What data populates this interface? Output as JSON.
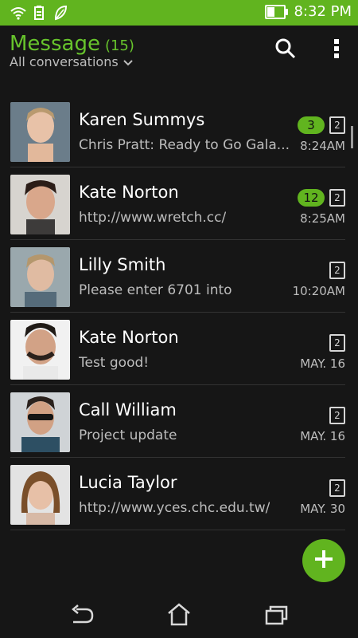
{
  "status": {
    "time": "8:32 PM",
    "battery_level": 0.4
  },
  "header": {
    "title": "Message",
    "count": "(15)",
    "subtitle": "All conversations"
  },
  "conversations": [
    {
      "name": "Karen Summys",
      "preview": "Chris Pratt: Ready to Go Gala...",
      "time": "8:24AM",
      "badge": "3",
      "sim": "2"
    },
    {
      "name": "Kate Norton",
      "preview": "http://www.wretch.cc/",
      "time": "8:25AM",
      "badge": "12",
      "sim": "2"
    },
    {
      "name": "Lilly Smith",
      "preview": "Please enter 6701 into",
      "time": "10:20AM",
      "badge": "",
      "sim": "2"
    },
    {
      "name": "Kate Norton",
      "preview": "Test good!",
      "time": "MAY. 16",
      "badge": "",
      "sim": "2"
    },
    {
      "name": "Call William",
      "preview": "Project update",
      "time": "MAY. 16",
      "badge": "",
      "sim": "2"
    },
    {
      "name": "Lucia Taylor",
      "preview": "http://www.yces.chc.edu.tw/",
      "time": "MAY.  30",
      "badge": "",
      "sim": "2"
    }
  ],
  "icons": {
    "search": "search-icon",
    "menu": "more-vert-icon",
    "fab": "plus-icon",
    "back": "back-icon",
    "home": "home-icon",
    "recents": "recents-icon"
  },
  "colors": {
    "accent": "#61b41f",
    "background": "#161616"
  }
}
